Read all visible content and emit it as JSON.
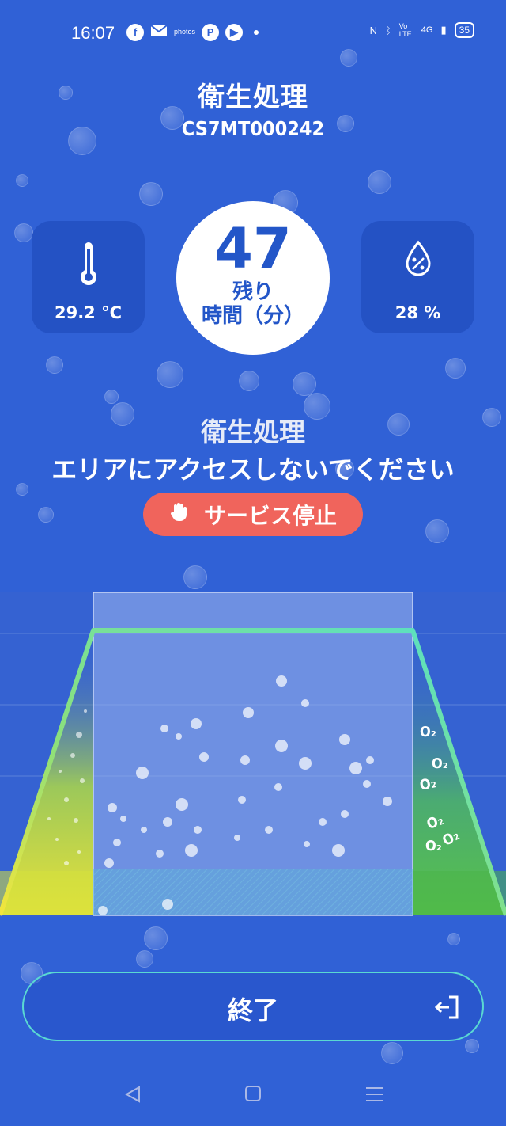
{
  "status_bar": {
    "time": "16:07",
    "notif_icons": [
      "facebook-icon",
      "mail-icon",
      "photos-icon",
      "paypay-icon",
      "play-icon"
    ],
    "photos_label": "photos",
    "signal_label": "4G",
    "volte_label": "Vo LTE",
    "battery": "35"
  },
  "header": {
    "title": "衛生処理",
    "device_id": "CS7MT000242"
  },
  "stats": {
    "temperature": "29.2 °C",
    "humidity": "28 %",
    "timer_value": "47",
    "timer_label_line1": "残り",
    "timer_label_line2": "時間（分）"
  },
  "warning": {
    "line1": "衛生処理",
    "line2": "エリアにアクセスしないでください"
  },
  "stop_button": {
    "label": "サービス停止"
  },
  "scene": {
    "o2_label": "O₂"
  },
  "end_button": {
    "label": "終了"
  },
  "colors": {
    "background": "#3061d6",
    "card": "#2452c4",
    "accent_red": "#f0645c",
    "outline_teal": "#5ad9d2"
  }
}
